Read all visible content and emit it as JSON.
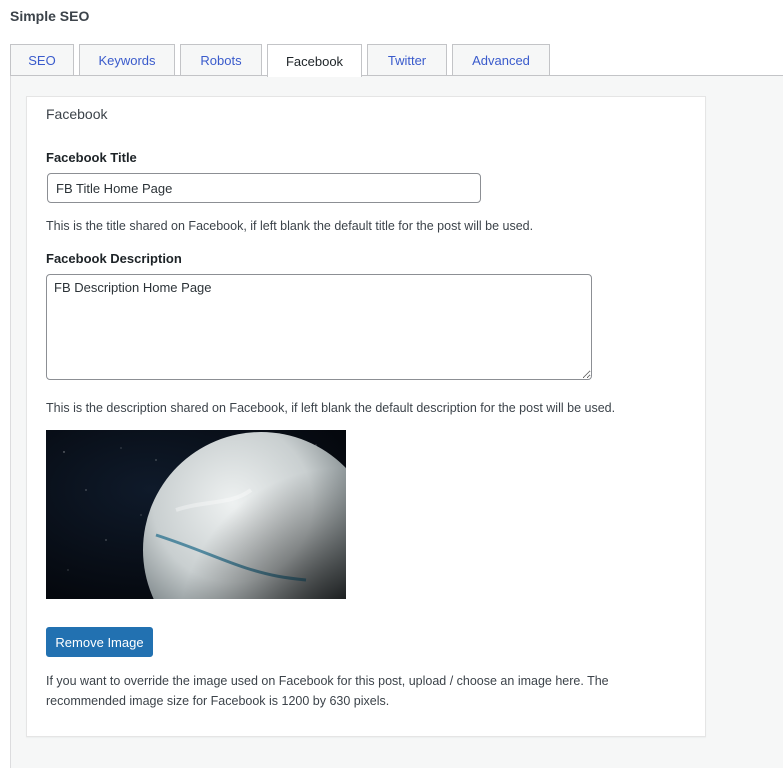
{
  "app": {
    "title": "Simple SEO"
  },
  "tabs": [
    {
      "label": "SEO",
      "active": false
    },
    {
      "label": "Keywords",
      "active": false
    },
    {
      "label": "Robots",
      "active": false
    },
    {
      "label": "Facebook",
      "active": true
    },
    {
      "label": "Twitter",
      "active": false
    },
    {
      "label": "Advanced",
      "active": false
    }
  ],
  "facebook": {
    "section_title": "Facebook",
    "title_label": "Facebook Title",
    "title_value": "FB Title Home Page",
    "title_help": "This is the title shared on Facebook, if left blank the default title for the post will be used.",
    "description_label": "Facebook Description",
    "description_value": "FB Description Home Page",
    "description_help": "This is the description shared on Facebook, if left blank the default description for the post will be used.",
    "remove_image_label": "Remove Image",
    "image_help_line1": "If you want to override the image used on Facebook for this post, upload / choose an image here. The",
    "image_help_line2": "recommended image size for Facebook is 1200 by 630 pixels."
  },
  "colors": {
    "primary_button": "#2271b1",
    "tab_link": "#3a5bcc",
    "panel_bg": "#f6f7f7"
  }
}
